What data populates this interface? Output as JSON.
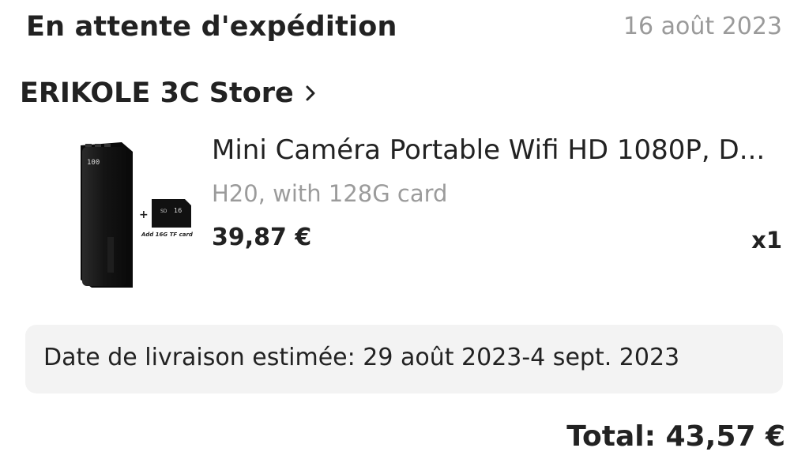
{
  "order": {
    "status": "En attente d'expédition",
    "date": "16 août 2023"
  },
  "store": {
    "name": "ERIKOLE 3C Store",
    "chevron_icon": "chevron-right-icon"
  },
  "item": {
    "title": "Mini Caméra Portable Wifi HD 1080P, D...",
    "variant": "H20, with 128G card",
    "price": "39,87 €",
    "quantity": "x1",
    "image_caption": "Add 16G TF card",
    "image_card_label": "16"
  },
  "delivery": {
    "text": "Date de livraison estimée: 29 août 2023-4 sept. 2023"
  },
  "summary": {
    "total": "Total: 43,57 €"
  }
}
